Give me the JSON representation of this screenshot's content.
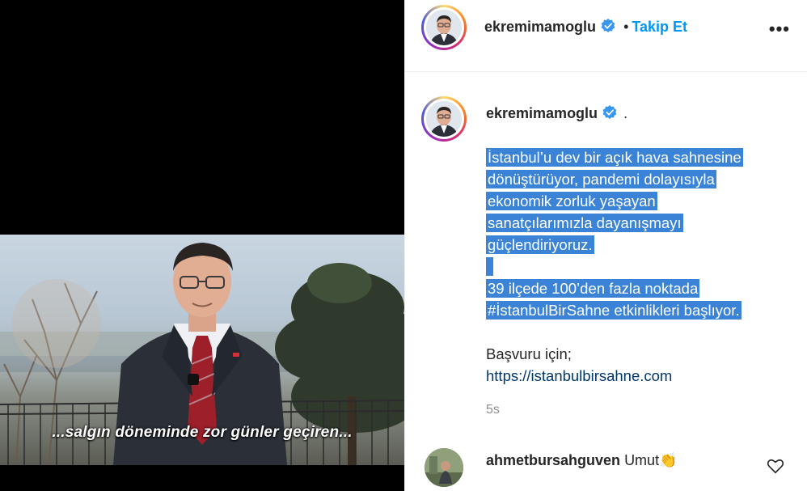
{
  "post": {
    "subtitle": "...salgın döneminde zor günler geçiren..."
  },
  "header": {
    "username": "ekremimamoglu",
    "separator": "•",
    "follow_label": "Takip Et",
    "more_label": "•••"
  },
  "caption": {
    "username": "ekremimamoglu",
    "suffix": ".",
    "lines_para1": [
      "İstanbul’u dev bir açık hava sahnesine",
      "dönüştürüyor, pandemi dolayısıyla",
      "ekonomik zorluk yaşayan",
      "sanatçılarımızla dayanışmayı",
      "güçlendiriyoruz."
    ],
    "lines_para2": [
      "39 ilçede 100’den fazla noktada",
      "#İstanbulBirSahne etkinlikleri başlıyor."
    ],
    "apply_text": "Başvuru için;",
    "link_text": "https://istanbulbirsahne.com",
    "time": "5s"
  },
  "comment": {
    "username": "ahmetbursahguven",
    "text": "Umut",
    "emoji": "👏"
  },
  "colors": {
    "accent": "#0095f6",
    "selection": "#3b83d6",
    "verified": "#3897f0"
  },
  "icons": [
    "verified-badge-icon",
    "more-options-icon",
    "heart-icon"
  ]
}
